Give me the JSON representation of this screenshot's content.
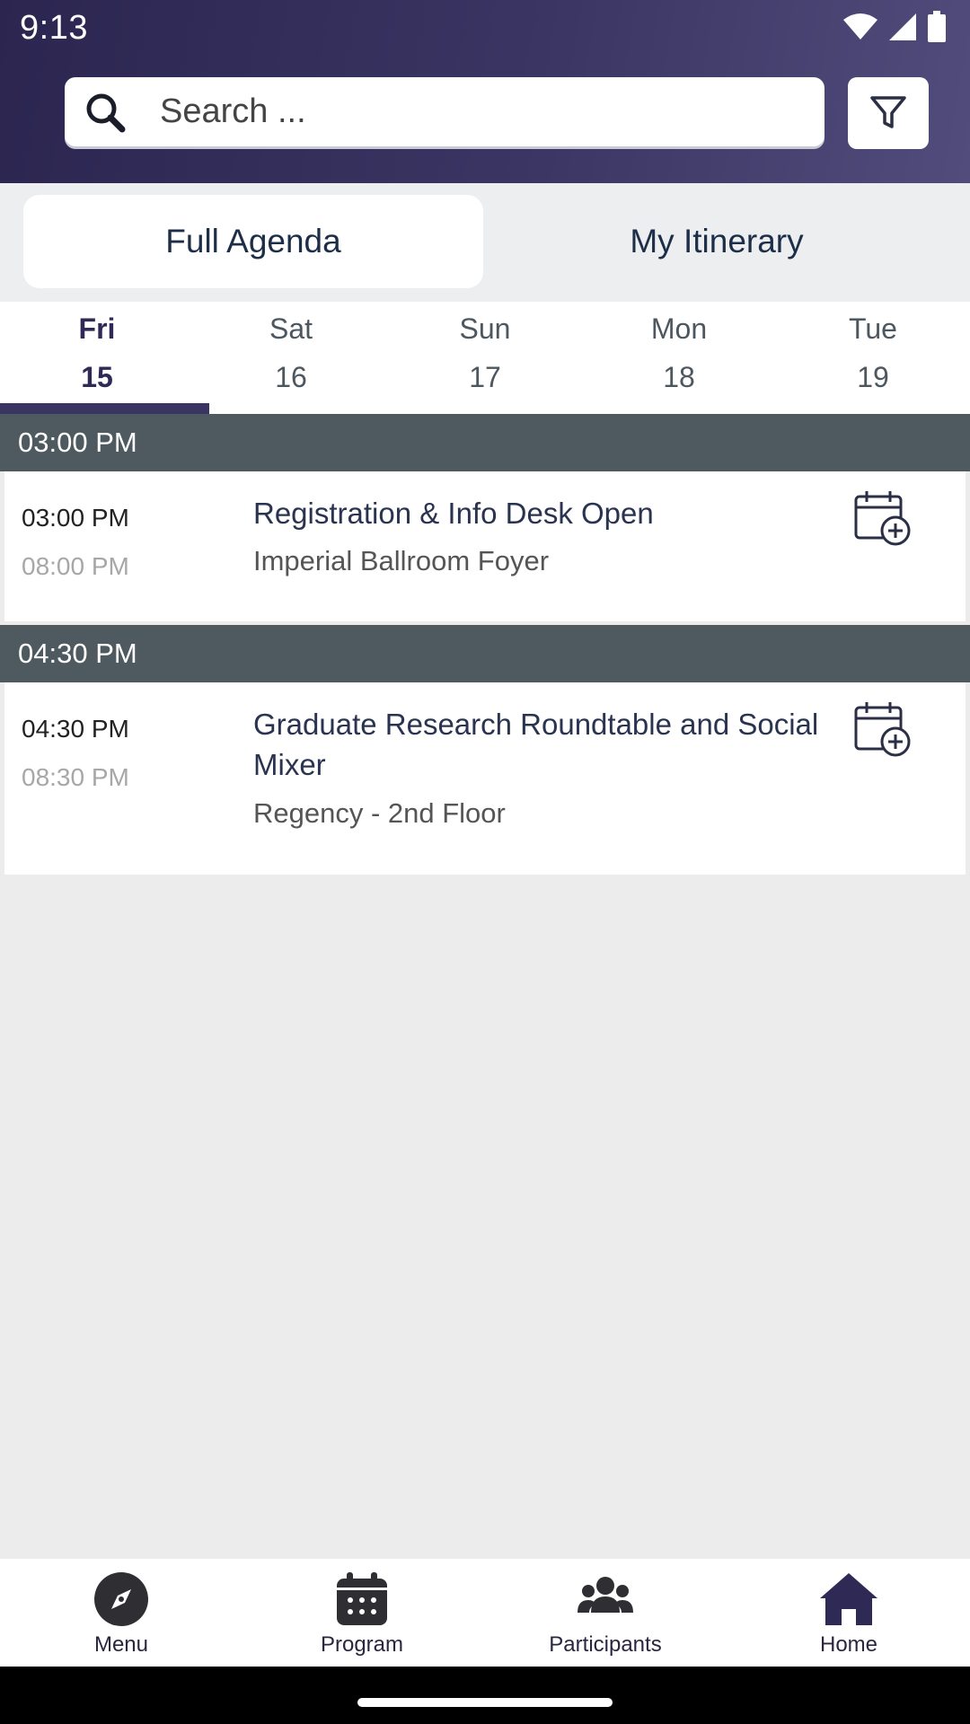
{
  "status": {
    "time": "9:13"
  },
  "search": {
    "placeholder": "Search ..."
  },
  "segments": {
    "full_agenda": "Full Agenda",
    "my_itinerary": "My Itinerary"
  },
  "days": [
    {
      "name": "Fri",
      "num": "15",
      "active": true
    },
    {
      "name": "Sat",
      "num": "16",
      "active": false
    },
    {
      "name": "Sun",
      "num": "17",
      "active": false
    },
    {
      "name": "Mon",
      "num": "18",
      "active": false
    },
    {
      "name": "Tue",
      "num": "19",
      "active": false
    }
  ],
  "groups": [
    {
      "header": "03:00 PM",
      "session": {
        "start": "03:00 PM",
        "end": "08:00 PM",
        "title": "Registration & Info Desk Open",
        "room": "Imperial Ballroom Foyer"
      }
    },
    {
      "header": "04:30 PM",
      "session": {
        "start": "04:30 PM",
        "end": "08:30 PM",
        "title": "Graduate Research Roundtable and Social Mixer",
        "room": "Regency - 2nd Floor"
      }
    }
  ],
  "nav": {
    "menu": "Menu",
    "program": "Program",
    "participants": "Participants",
    "home": "Home"
  },
  "colors": {
    "header_dark": "#2b2550",
    "accent": "#3a3463",
    "time_header": "#4e5a60"
  }
}
